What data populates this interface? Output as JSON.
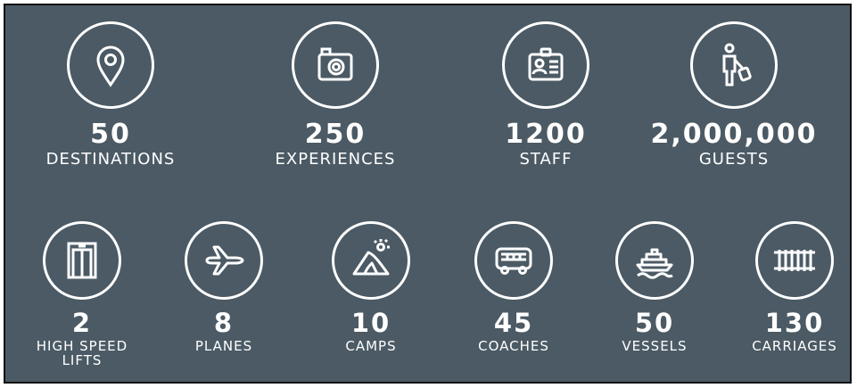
{
  "top_stats": [
    {
      "icon": "location-pin-icon",
      "value": "50",
      "label": "DESTINATIONS"
    },
    {
      "icon": "camera-icon",
      "value": "250",
      "label": "EXPERIENCES"
    },
    {
      "icon": "id-badge-icon",
      "value": "1200",
      "label": "STAFF"
    },
    {
      "icon": "traveler-luggage-icon",
      "value": "2,000,000",
      "label": "GUESTS"
    }
  ],
  "bottom_stats": [
    {
      "icon": "elevator-icon",
      "value": "2",
      "label_line1": "HIGH SPEED",
      "label_line2": "LIFTS"
    },
    {
      "icon": "airplane-icon",
      "value": "8",
      "label": "PLANES"
    },
    {
      "icon": "tent-camp-icon",
      "value": "10",
      "label": "CAMPS"
    },
    {
      "icon": "coach-bus-icon",
      "value": "45",
      "label": "COACHES"
    },
    {
      "icon": "cruise-ship-icon",
      "value": "50",
      "label": "VESSELS"
    },
    {
      "icon": "railway-track-icon",
      "value": "130",
      "label": "CARRIAGES"
    }
  ],
  "colors": {
    "background": "#4b5a64",
    "foreground": "#ffffff",
    "border": "#111111"
  }
}
